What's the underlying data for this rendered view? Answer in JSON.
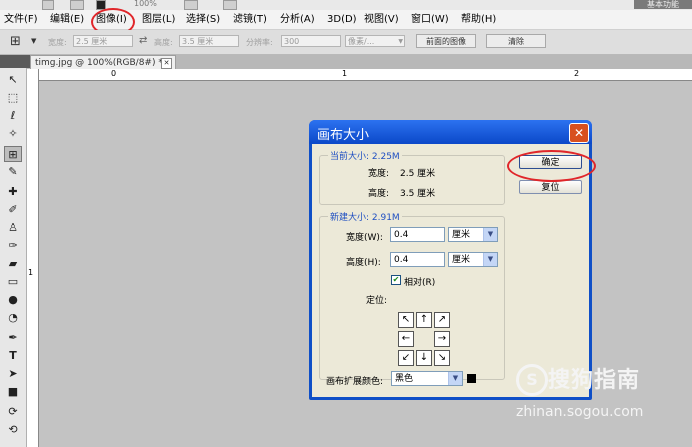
{
  "top_strip": {
    "zoom": "100%",
    "right_label": "基本功能"
  },
  "menu": {
    "items": [
      "文件(F)",
      "编辑(E)",
      "图像(I)",
      "图层(L)",
      "选择(S)",
      "滤镜(T)",
      "分析(A)",
      "3D(D)",
      "视图(V)",
      "窗口(W)",
      "帮助(H)"
    ]
  },
  "options_bar": {
    "width_label": "宽度:",
    "width_value": "2.5 厘米",
    "height_label": "高度:",
    "height_value": "3.5 厘米",
    "resolution_label": "分辨率:",
    "resolution_value": "300",
    "unit_value": "像素/...",
    "front_image_button": "前面的图像",
    "clear_button": "清除"
  },
  "document": {
    "tab_title": "timg.jpg @ 100%(RGB/8#) *"
  },
  "rulers": {
    "h_marks": [
      "0",
      "1",
      "2"
    ],
    "v_marks": [
      "1"
    ]
  },
  "dialog": {
    "title": "画布大小",
    "ok_button": "确定",
    "reset_button": "复位",
    "current": {
      "title": "当前大小: 2.25M",
      "width_label": "宽度:",
      "width_value": "2.5 厘米",
      "height_label": "高度:",
      "height_value": "3.5 厘米"
    },
    "new_size": {
      "title": "新建大小: 2.91M",
      "width_label": "宽度(W):",
      "width_value": "0.4",
      "width_unit": "厘米",
      "height_label": "高度(H):",
      "height_value": "0.4",
      "height_unit": "厘米",
      "relative_label": "相对(R)",
      "relative_checked": true,
      "anchor_label": "定位:"
    },
    "extension_color_label": "画布扩展颜色:",
    "extension_color_value": "黑色",
    "extension_color_swatch": "#000000"
  },
  "watermark": {
    "brand": "搜狗指南",
    "url": "zhinan.sogou.com"
  },
  "colors": {
    "highlight_circle": "#e0262a",
    "dialog_title": "#0f4fc7"
  }
}
